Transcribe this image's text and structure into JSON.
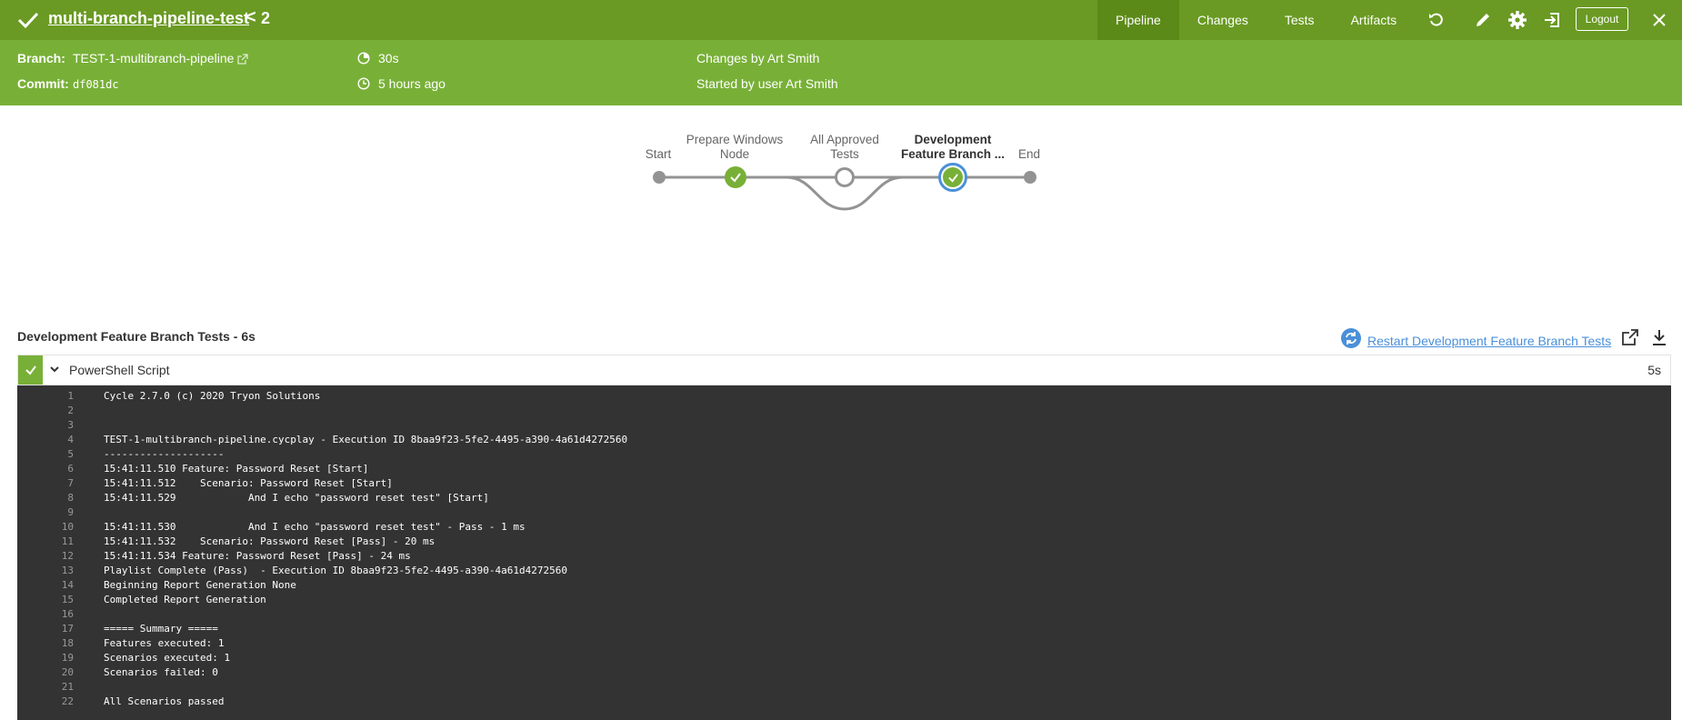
{
  "header": {
    "title": "multi-branch-pipeline-test",
    "separator": "<",
    "run_number": "2",
    "tabs": [
      "Pipeline",
      "Changes",
      "Tests",
      "Artifacts"
    ],
    "active_tab": "Pipeline",
    "logout_label": "Logout",
    "icons": [
      "check-icon",
      "replay-icon",
      "edit-icon",
      "gear-icon",
      "exit-icon",
      "close-icon"
    ],
    "color": "#6a9a23"
  },
  "info": {
    "branch_label": "Branch:",
    "branch_value": "TEST-1-multibranch-pipeline",
    "commit_label": "Commit:",
    "commit_value": "df081dc",
    "duration": "30s",
    "time": "5 hours ago",
    "changes": "Changes by Art Smith",
    "started": "Started by user Art Smith",
    "color": "#78b037"
  },
  "pipeline": {
    "stages": [
      {
        "label": "Start",
        "status": "start"
      },
      {
        "label": "Prepare Windows\nNode",
        "status": "success"
      },
      {
        "label": "All Approved\nTests",
        "status": "not-built"
      },
      {
        "label": "Development\nFeature Branch ...",
        "status": "success-selected"
      },
      {
        "label": "End",
        "status": "end"
      }
    ]
  },
  "step": {
    "title": "Development Feature Branch Tests - 6s",
    "restart_label": "Restart Development Feature Branch Tests",
    "script_name": "PowerShell Script",
    "script_duration": "5s"
  },
  "log": [
    {
      "n": "1",
      "t": "Cycle 2.7.0 (c) 2020 Tryon Solutions"
    },
    {
      "n": "2",
      "t": ""
    },
    {
      "n": "3",
      "t": ""
    },
    {
      "n": "4",
      "t": "TEST-1-multibranch-pipeline.cycplay - Execution ID 8baa9f23-5fe2-4495-a390-4a61d4272560"
    },
    {
      "n": "5",
      "t": "--------------------"
    },
    {
      "n": "6",
      "t": "15:41:11.510 Feature: Password Reset [Start]"
    },
    {
      "n": "7",
      "t": "15:41:11.512    Scenario: Password Reset [Start]"
    },
    {
      "n": "8",
      "t": "15:41:11.529            And I echo \"password reset test\" [Start]"
    },
    {
      "n": "9",
      "t": ""
    },
    {
      "n": "10",
      "t": "15:41:11.530            And I echo \"password reset test\" - Pass - 1 ms"
    },
    {
      "n": "11",
      "t": "15:41:11.532    Scenario: Password Reset [Pass] - 20 ms"
    },
    {
      "n": "12",
      "t": "15:41:11.534 Feature: Password Reset [Pass] - 24 ms"
    },
    {
      "n": "13",
      "t": "Playlist Complete (Pass)  - Execution ID 8baa9f23-5fe2-4495-a390-4a61d4272560"
    },
    {
      "n": "14",
      "t": "Beginning Report Generation None"
    },
    {
      "n": "15",
      "t": "Completed Report Generation"
    },
    {
      "n": "16",
      "t": ""
    },
    {
      "n": "17",
      "t": "===== Summary ====="
    },
    {
      "n": "18",
      "t": "Features executed: 1"
    },
    {
      "n": "19",
      "t": "Scenarios executed: 1"
    },
    {
      "n": "20",
      "t": "Scenarios failed: 0"
    },
    {
      "n": "21",
      "t": ""
    },
    {
      "n": "22",
      "t": "All Scenarios passed"
    }
  ]
}
